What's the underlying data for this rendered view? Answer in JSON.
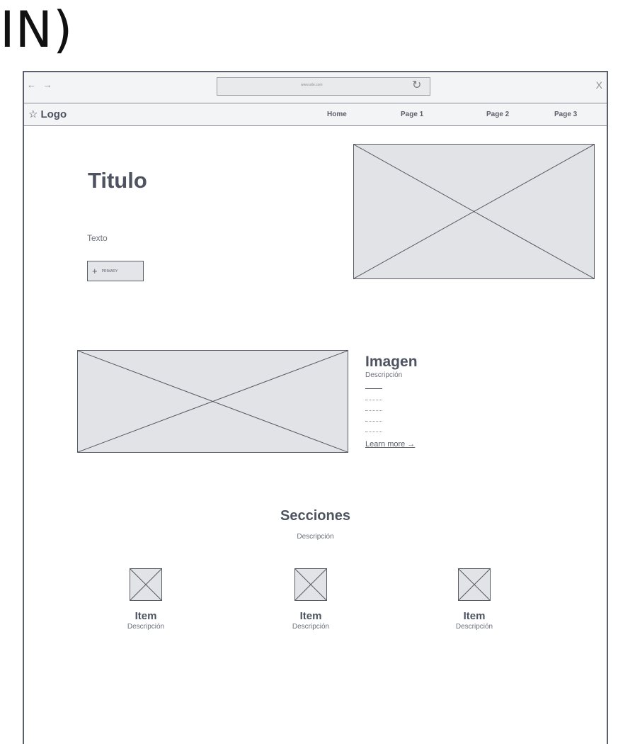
{
  "corner_label": "IN)",
  "browser": {
    "nav_arrows": "← →",
    "url": "www.site.com",
    "reload_icon": "↻",
    "close_label": "X"
  },
  "site_nav": {
    "logo_icon": "☆",
    "logo_text": "Logo",
    "links": [
      "Home",
      "Page 1",
      "Page 2",
      "Page 3"
    ]
  },
  "hero": {
    "title": "Titulo",
    "text": "Texto",
    "button_icon": "+",
    "button_label": "PRIMARY"
  },
  "feature": {
    "title": "Imagen",
    "description": "Descripción",
    "learn_more": "Learn more →"
  },
  "sections": {
    "title": "Secciones",
    "description": "Descripción",
    "items": [
      {
        "title": "Item",
        "description": "Descripción"
      },
      {
        "title": "Item",
        "description": "Descripción"
      },
      {
        "title": "Item",
        "description": "Descripción"
      }
    ]
  },
  "colors": {
    "outline": "#555a64",
    "placeholder_fill": "#e2e3e6",
    "text": "#4d5360"
  }
}
